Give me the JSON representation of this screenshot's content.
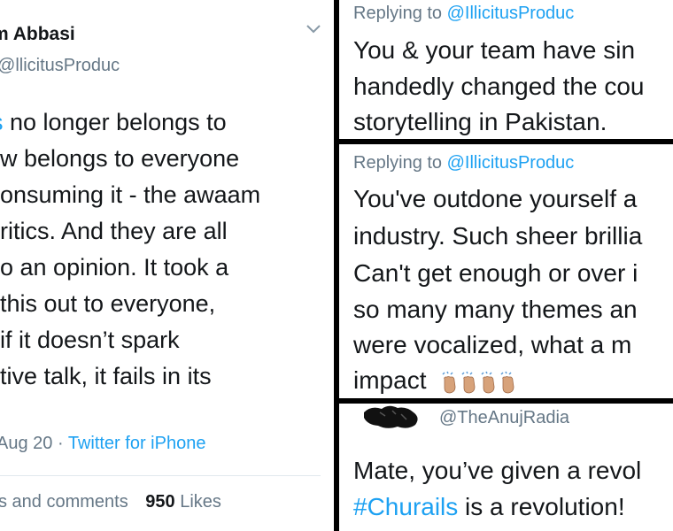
{
  "left_tweet": {
    "name": "m Abbasi",
    "handle": "llicitusProduc",
    "lines": [
      {
        "lead": "s",
        "text": " no longer belongs to"
      },
      {
        "text": "w belongs to everyone"
      },
      {
        "text": "onsuming it - the awaam"
      },
      {
        "text": "ritics. And they are all"
      },
      {
        "text": "o an opinion. It took a"
      },
      {
        "text": "this out to everyone,"
      },
      {
        "text": "if it doesn’t spark"
      },
      {
        "text": "tive talk, it fails in its"
      }
    ],
    "date": "Aug 20 · ",
    "source": "Twitter for iPhone",
    "stats_label": "s and comments",
    "likes_count": "950",
    "likes_label": "Likes"
  },
  "reply1": {
    "replying_prefix": "Replying to ",
    "replying_handle": "@IllicitusProduc",
    "lines": [
      "You & your team have sin",
      "handedly changed the cou",
      "storytelling in Pakistan."
    ]
  },
  "reply2": {
    "replying_prefix": "Replying to ",
    "replying_handle": "@IllicitusProduc",
    "lines": [
      "You've outdone yourself a",
      "industry. Such sheer brillia",
      "Can't get enough or over i",
      "so many many themes an",
      "were vocalized, what a m",
      "impact"
    ],
    "emoji": "clapping-hands-medium-light-skin-tone x4"
  },
  "reply3": {
    "handle": "@TheAnujRadia",
    "line1": "Mate, you’ve given a revol",
    "hashtag": "#Churails",
    "line2_rest": " is a revolution!"
  },
  "colors": {
    "link": "#1da1f2",
    "text": "#14171a",
    "muted": "#657786",
    "separator": "#000000"
  }
}
